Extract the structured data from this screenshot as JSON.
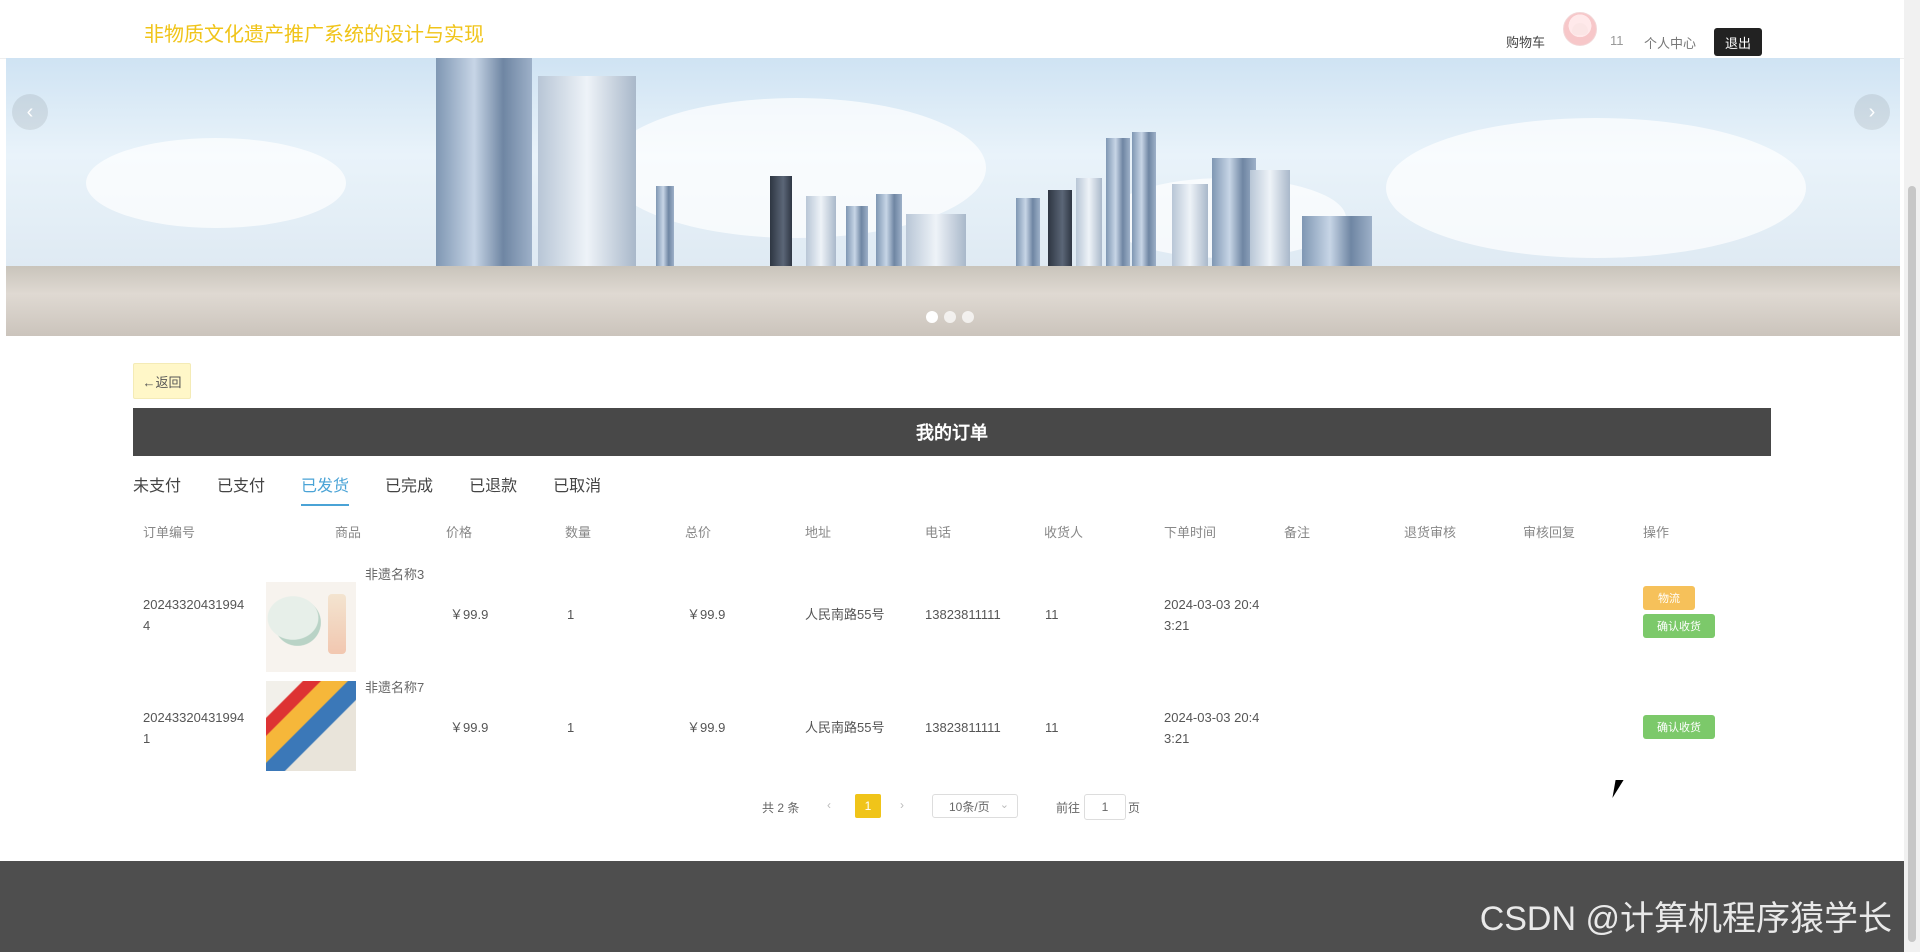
{
  "header": {
    "site_title": "非物质文化遗产推广系统的设计与实现",
    "cart": "购物车",
    "username": "11",
    "personal_center": "个人中心",
    "logout": "退出"
  },
  "banner": {
    "prev": "‹",
    "next": "›",
    "slide_count": 3,
    "active_slide": 1
  },
  "back": "←返回",
  "orders_title": "我的订单",
  "tabs": [
    "未支付",
    "已支付",
    "已发货",
    "已完成",
    "已退款",
    "已取消"
  ],
  "active_tab": 2,
  "table": {
    "headers": [
      "订单编号",
      "商品",
      "价格",
      "数量",
      "总价",
      "地址",
      "电话",
      "收货人",
      "下单时间",
      "备注",
      "退货审核",
      "审核回复",
      "操作"
    ],
    "rows": [
      {
        "order_no_1": "20243320431994",
        "order_no_2": "4",
        "product": "非遗名称3",
        "price": "￥99.9",
        "qty": "1",
        "total": "￥99.9",
        "address": "人民南路55号",
        "phone": "13823811111",
        "receiver": "11",
        "time_1": "2024-03-03 20:4",
        "time_2": "3:21",
        "btn_logistics": "物流",
        "btn_confirm": "确认收货"
      },
      {
        "order_no_1": "20243320431994",
        "order_no_2": "1",
        "product": "非遗名称7",
        "price": "￥99.9",
        "qty": "1",
        "total": "￥99.9",
        "address": "人民南路55号",
        "phone": "13823811111",
        "receiver": "11",
        "time_1": "2024-03-03 20:4",
        "time_2": "3:21",
        "btn_confirm": "确认收货"
      }
    ]
  },
  "pagination": {
    "total": "共 2 条",
    "prev": "‹",
    "current": "1",
    "next": "›",
    "page_size": "10条/页",
    "goto": "前往",
    "goto_value": "1",
    "page_unit": "页"
  },
  "watermark": "CSDN @计算机程序猿学长",
  "colors": {
    "accent": "#f0c419",
    "tab_active": "#4aa3d6",
    "header_bar": "#484848",
    "footer": "#4e4e4e",
    "btn_green": "#7cc96a",
    "btn_orange": "#f6c15a"
  }
}
